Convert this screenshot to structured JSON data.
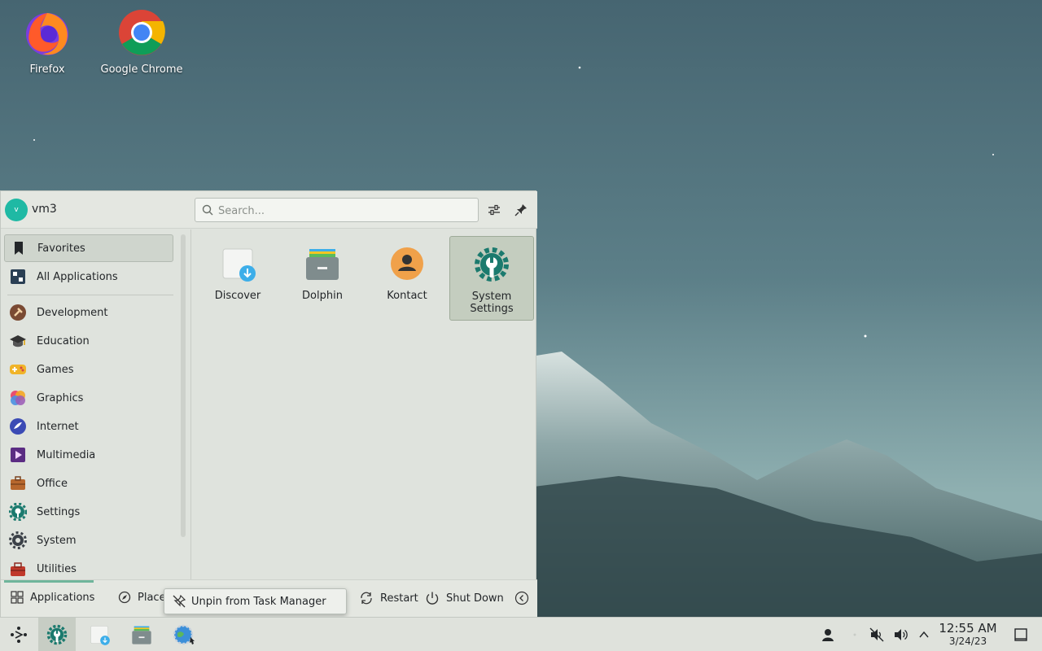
{
  "desktop": {
    "icons": [
      {
        "label": "Firefox",
        "icon": "firefox-icon"
      },
      {
        "label": "Google Chrome",
        "icon": "chrome-icon"
      }
    ]
  },
  "launcher": {
    "user": {
      "initial": "v",
      "name": "vm3"
    },
    "search_placeholder": "Search...",
    "categories": [
      {
        "label": "Favorites",
        "icon": "bookmark-icon"
      },
      {
        "label": "All Applications",
        "icon": "grid-icon"
      },
      {
        "label": "Development",
        "icon": "hammer-icon"
      },
      {
        "label": "Education",
        "icon": "graduation-cap-icon"
      },
      {
        "label": "Games",
        "icon": "gamepad-icon"
      },
      {
        "label": "Graphics",
        "icon": "palette-icon"
      },
      {
        "label": "Internet",
        "icon": "globe-icon"
      },
      {
        "label": "Multimedia",
        "icon": "multimedia-icon"
      },
      {
        "label": "Office",
        "icon": "briefcase-icon"
      },
      {
        "label": "Settings",
        "icon": "settings-gear-icon"
      },
      {
        "label": "System",
        "icon": "system-gear-icon"
      },
      {
        "label": "Utilities",
        "icon": "toolbox-icon"
      }
    ],
    "favorites": [
      {
        "label": "Discover",
        "icon": "discover-icon"
      },
      {
        "label": "Dolphin",
        "icon": "dolphin-icon"
      },
      {
        "label": "Kontact",
        "icon": "kontact-icon"
      },
      {
        "label": "System Settings",
        "label_line1": "System",
        "label_line2": "Settings",
        "icon": "system-settings-icon"
      }
    ],
    "footer": {
      "applications": "Applications",
      "places": "Place",
      "restart": "Restart",
      "shutdown": "Shut Down"
    }
  },
  "context_menu": {
    "item": "Unpin from Task Manager"
  },
  "taskbar": {
    "clock_time": "12:55 AM",
    "clock_date": "3/24/23"
  },
  "colors": {
    "accent": "#6fb59b",
    "selection": "#c4cdbf"
  }
}
